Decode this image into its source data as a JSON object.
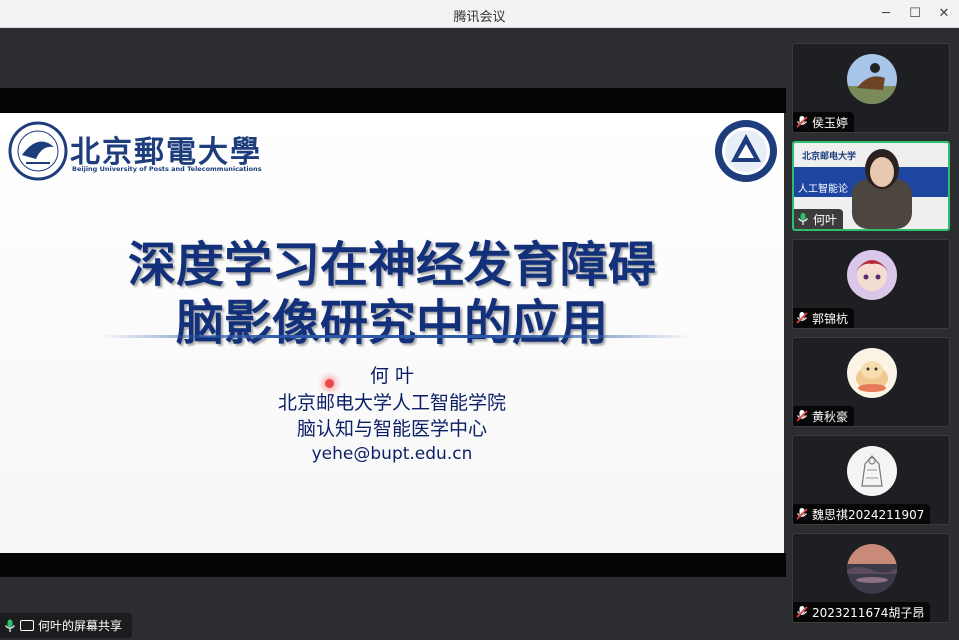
{
  "window": {
    "title": "腾讯会议",
    "min": "─",
    "max": "☐",
    "close": "✕"
  },
  "slide": {
    "school_cn": "北京郵電大學",
    "school_en": "Beijing University of Posts and Telecommunications",
    "title_line1": "深度学习在神经发育障碍",
    "title_line2": "脑影像研究中的应用",
    "presenter": "何 叶",
    "institute": "北京邮电大学人工智能学院",
    "center": "脑认知与智能医学中心",
    "email": "yehe@bupt.edu.cn"
  },
  "share": {
    "label": "何叶的屏幕共享"
  },
  "participants": [
    {
      "name": "侯玉婷",
      "muted": true
    },
    {
      "name": "何叶",
      "muted": false,
      "band_text": "人工智能论",
      "mini_school": "北京邮电大学"
    },
    {
      "name": "郭锦杭",
      "muted": true
    },
    {
      "name": "黄秋豪",
      "muted": true
    },
    {
      "name": "魏思祺2024211907",
      "muted": true
    },
    {
      "name": "2023211674胡子昂",
      "muted": true
    }
  ],
  "colors": {
    "accent_green": "#2fbe6e",
    "slide_blue": "#13307a",
    "muted_red": "#e04040"
  }
}
